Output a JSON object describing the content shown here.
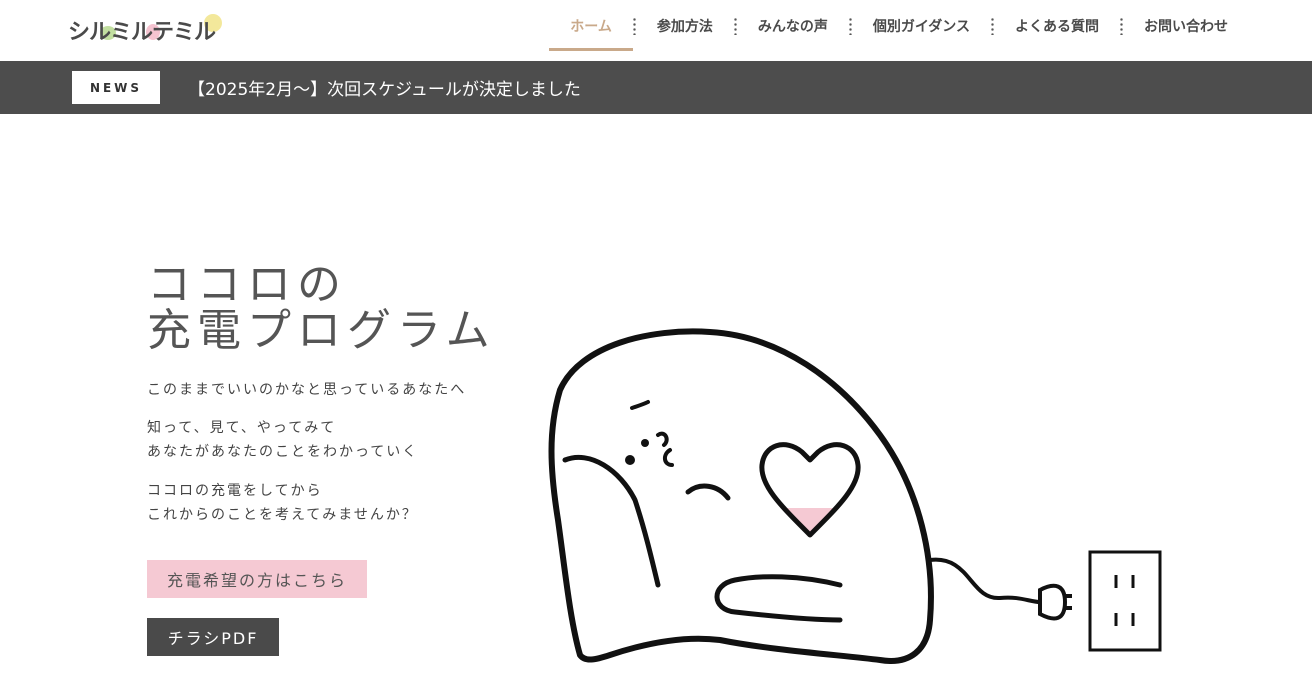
{
  "logo": {
    "text": "シルミルテミル"
  },
  "nav": {
    "items": [
      {
        "label": "ホーム",
        "active": true
      },
      {
        "label": "参加方法"
      },
      {
        "label": "みんなの声"
      },
      {
        "label": "個別ガイダンス"
      },
      {
        "label": "よくある質問"
      },
      {
        "label": "お問い合わせ"
      }
    ]
  },
  "news": {
    "badge": "NEWS",
    "headline": "【2025年2月〜】次回スケジュールが決定しました"
  },
  "hero": {
    "title_line1": "ココロの",
    "title_line2": "充電プログラム",
    "lead": "このままでいいのかなと思っているあなたへ",
    "para2_line1": "知って、見て、やってみて",
    "para2_line2": "あなたがあなたのことをわかっていく",
    "para3_line1": "ココロの充電をしてから",
    "para3_line2": "これからのことを考えてみませんか？",
    "apply_button": "充電希望の方はこちら",
    "pdf_button": "チラシPDF"
  },
  "colors": {
    "accent": "#c9a98a",
    "news_bar": "#4d4d4d",
    "pink_button": "#f5c9d3",
    "dark_button": "#4a4a4a",
    "heart_fill": "#f5c9d3"
  }
}
